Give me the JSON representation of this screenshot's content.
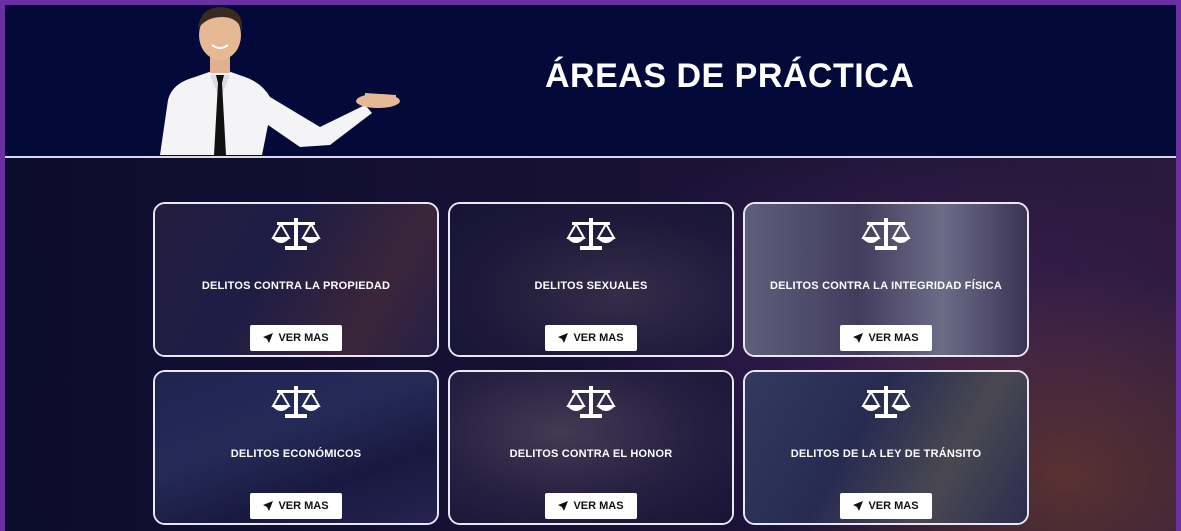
{
  "header": {
    "title": "ÁREAS DE PRÁCTICA"
  },
  "cards": [
    {
      "label": "DELITOS CONTRA LA PROPIEDAD",
      "button": "VER MAS",
      "icon": "scales-icon"
    },
    {
      "label": "DELITOS SEXUALES",
      "button": "VER MAS",
      "icon": "scales-icon"
    },
    {
      "label": "DELITOS CONTRA LA INTEGRIDAD FÍSICA",
      "button": "VER MAS",
      "icon": "scales-icon"
    },
    {
      "label": "DELITOS ECONÓMICOS",
      "button": "VER MAS",
      "icon": "scales-icon"
    },
    {
      "label": "DELITOS CONTRA EL HONOR",
      "button": "VER MAS",
      "icon": "scales-icon"
    },
    {
      "label": "DELITOS DE LA LEY DE TRÁNSITO",
      "button": "VER MAS",
      "icon": "scales-icon"
    }
  ],
  "colors": {
    "frame_border": "#6a2fa0",
    "header_bg": "#030a3a",
    "button_bg": "#ffffff",
    "text": "#ffffff"
  }
}
